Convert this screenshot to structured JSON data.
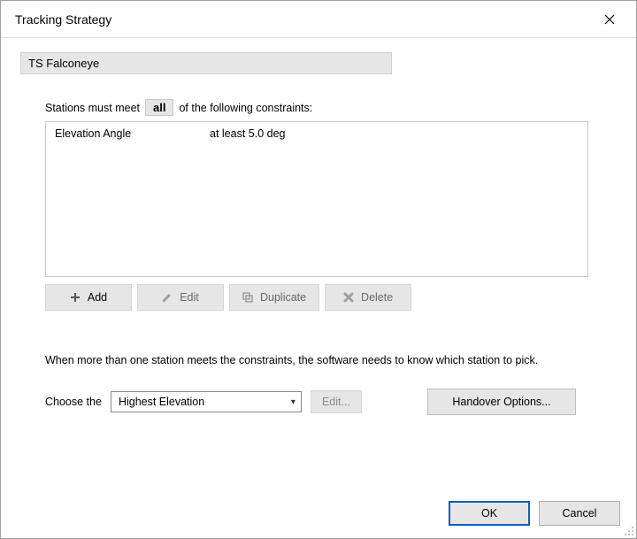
{
  "window": {
    "title": "Tracking Strategy"
  },
  "name_field": "TS Falconeye",
  "constraints": {
    "prefix": "Stations must meet",
    "qualifier": "all",
    "suffix": "of the following constraints:",
    "items": [
      {
        "label": "Elevation Angle",
        "condition": "at least 5.0 deg"
      }
    ]
  },
  "toolbar": {
    "add": "Add",
    "edit": "Edit",
    "duplicate": "Duplicate",
    "delete": "Delete"
  },
  "pick": {
    "explain": "When more than one station meets the constraints, the software needs to know which station to pick.",
    "choose_label": "Choose the",
    "selected": "Highest Elevation",
    "edit_label": "Edit...",
    "handover_label": "Handover Options..."
  },
  "footer": {
    "ok": "OK",
    "cancel": "Cancel"
  }
}
